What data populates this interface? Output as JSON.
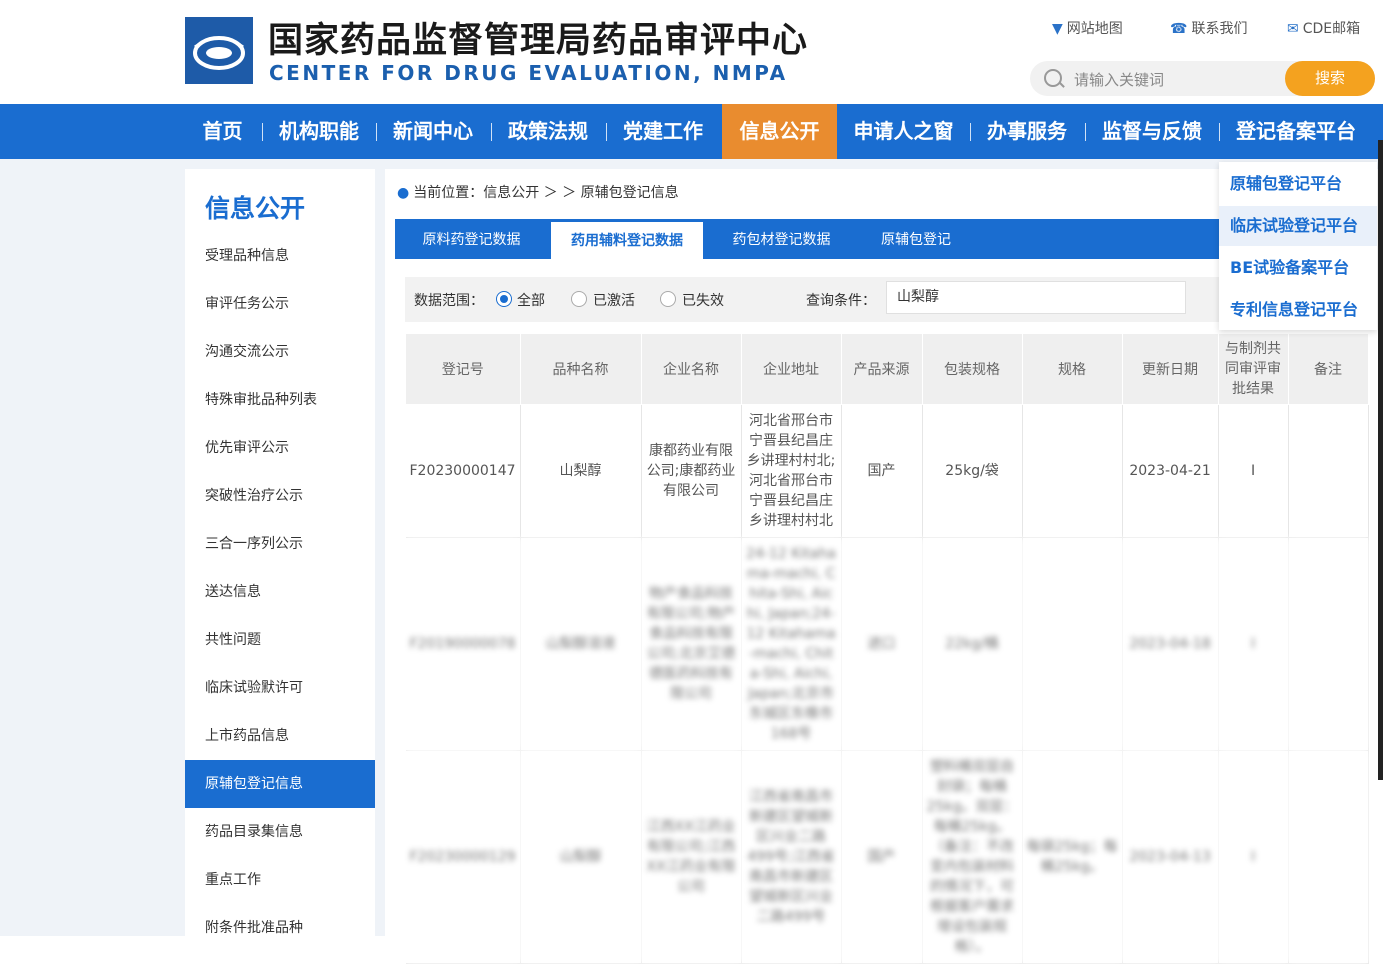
{
  "header": {
    "title_cn": "国家药品监督管理局药品审评中心",
    "title_en": "CENTER FOR DRUG EVALUATION, NMPA",
    "links": [
      {
        "label": "网站地图",
        "icon": "map-pin-icon"
      },
      {
        "label": "联系我们",
        "icon": "phone-icon"
      },
      {
        "label": "CDE邮箱",
        "icon": "mail-icon"
      }
    ],
    "search_placeholder": "请输入关键词",
    "search_button": "搜索"
  },
  "nav": {
    "items": [
      "首页",
      "机构职能",
      "新闻中心",
      "政策法规",
      "党建工作",
      "信息公开",
      "申请人之窗",
      "办事服务",
      "监督与反馈",
      "登记备案平台"
    ],
    "active": "信息公开"
  },
  "dropdown": {
    "items": [
      "原辅包登记平台",
      "临床试验登记平台",
      "BE试验备案平台",
      "专利信息登记平台"
    ]
  },
  "sidebar": {
    "title": "信息公开",
    "items": [
      "受理品种信息",
      "审评任务公示",
      "沟通交流公示",
      "特殊审批品种列表",
      "优先审评公示",
      "突破性治疗公示",
      "三合一序列公示",
      "送达信息",
      "共性问题",
      "临床试验默许可",
      "上市药品信息",
      "原辅包登记信息",
      "药品目录集信息",
      "重点工作",
      "附条件批准品种"
    ],
    "active": "原辅包登记信息"
  },
  "breadcrumb": {
    "text": "当前位置：信息公开 ＞ ＞ 原辅包登记信息"
  },
  "tabs": {
    "items": [
      "原料药登记数据",
      "药用辅料登记数据",
      "药包材登记数据",
      "原辅包登记"
    ],
    "active": "药用辅料登记数据"
  },
  "filter": {
    "range_label": "数据范围：",
    "options": [
      "全部",
      "已激活",
      "已失效"
    ],
    "selected": "全部",
    "query_label": "查询条件：",
    "query_value": "山梨醇"
  },
  "table": {
    "headers": [
      "登记号",
      "品种名称",
      "企业名称",
      "企业地址",
      "产品来源",
      "包装规格",
      "规格",
      "更新日期",
      "与制剂共同审评审批结果",
      "备注"
    ],
    "rows": [
      [
        "F20230000147",
        "山梨醇",
        "康都药业有限公司;康都药业有限公司",
        "河北省邢台市宁晋县纪昌庄乡讲理村村北;河北省邢台市宁晋县纪昌庄乡讲理村村北",
        "国产",
        "25kg/袋",
        "",
        "2023-04-21",
        "I",
        ""
      ],
      [
        "F20190000078",
        "山梨醇溶液",
        "物产食品科技有限公司;物产食品科技有限公司;北京艾德德医药科技有限公司",
        "24-12 Kitahama-machi, Chita-Shi, Aichi, Japan;24-12 Kitahama-machi, Chita-Shi, Aichi, Japan;北京市东城区东橡市168号",
        "进口",
        "22kg/桶",
        "",
        "2023-04-18",
        "I",
        ""
      ],
      [
        "F20230000129",
        "山梨醇",
        "江西XX江药业有限公司;江西XX江药业有限公司",
        "江西省南昌市新建区望城新区兴业二路499号;江西省南昌市新建区望城新区兴业二路499号",
        "国产",
        "塑料桶双层自封袋；每桶25kg。双层：每桶25kg。（备注：不改变内包装材料的情况下，可根据客户需求增设包装规格）。",
        "每袋25kg；每桶25kg。",
        "2023-04-13",
        "I",
        ""
      ]
    ]
  }
}
